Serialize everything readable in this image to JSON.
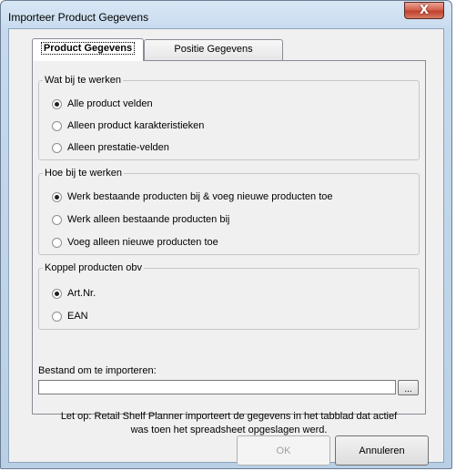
{
  "window": {
    "title": "Importeer Product Gegevens",
    "close_label": "X"
  },
  "tabs": [
    {
      "label": "Product Gegevens",
      "active": true
    },
    {
      "label": "Positie Gegevens",
      "active": false
    }
  ],
  "groups": {
    "what": {
      "legend": "Wat bij te werken",
      "options": [
        {
          "label": "Alle product velden",
          "checked": true
        },
        {
          "label": "Alleen product karakteristieken",
          "checked": false
        },
        {
          "label": "Alleen prestatie-velden",
          "checked": false
        }
      ]
    },
    "how": {
      "legend": "Hoe bij te werken",
      "options": [
        {
          "label": "Werk bestaande producten bij & voeg nieuwe producten toe",
          "checked": true
        },
        {
          "label": "Werk alleen bestaande producten bij",
          "checked": false
        },
        {
          "label": "Voeg alleen nieuwe producten toe",
          "checked": false
        }
      ]
    },
    "link": {
      "legend": "Koppel producten obv",
      "options": [
        {
          "label": "Art.Nr.",
          "checked": true
        },
        {
          "label": "EAN",
          "checked": false
        }
      ]
    }
  },
  "file": {
    "label": "Bestand om te importeren:",
    "value": "",
    "browse_label": "..."
  },
  "note": {
    "line1": "Let op: Retail Shelf Planner importeert de gegevens in het tabblad dat actief",
    "line2": "was toen het spreadsheet opgeslagen werd."
  },
  "buttons": {
    "ok": "OK",
    "cancel": "Annuleren"
  }
}
